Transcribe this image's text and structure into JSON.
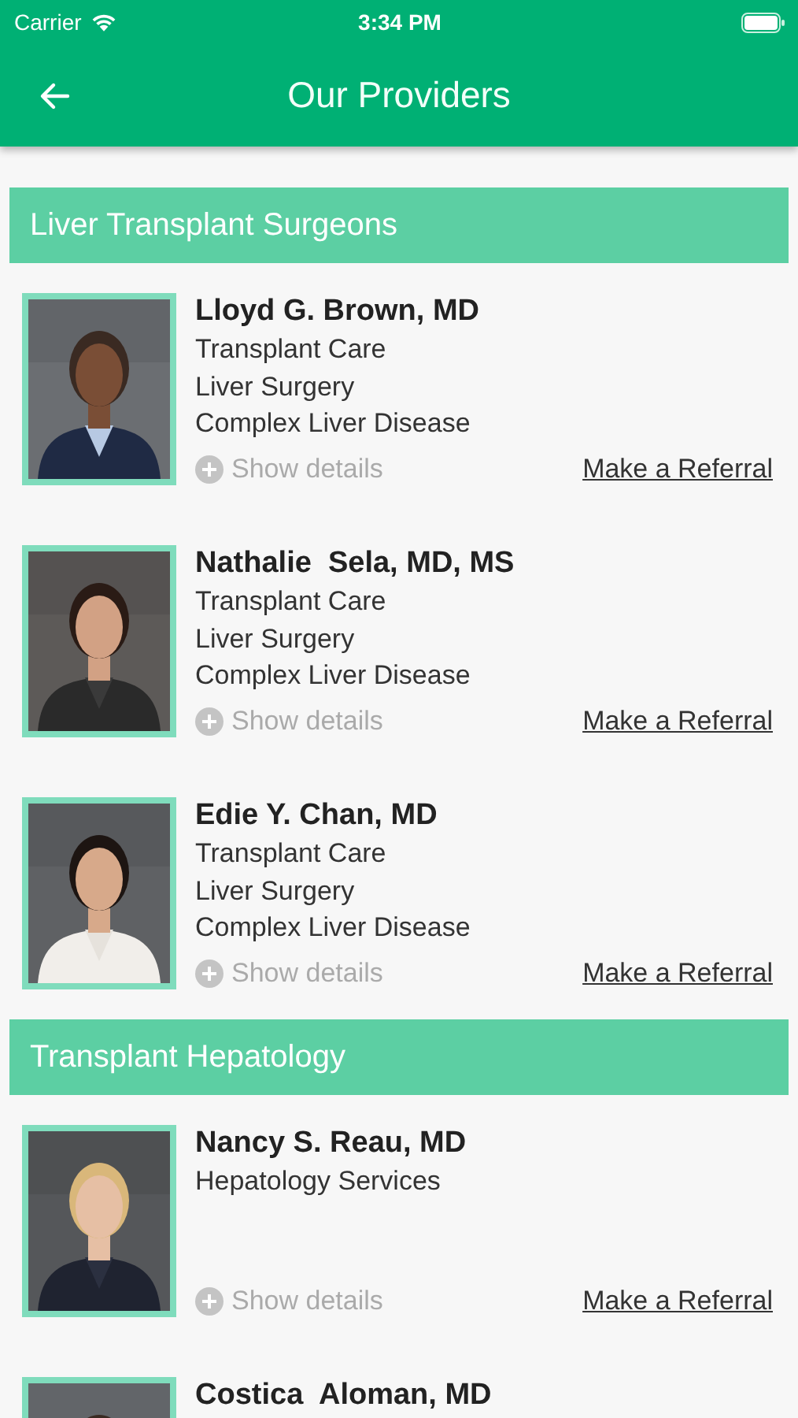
{
  "status_bar": {
    "carrier": "Carrier",
    "time": "3:34 PM"
  },
  "header": {
    "title": "Our Providers"
  },
  "sections": [
    {
      "title": "Liver Transplant Surgeons",
      "providers": [
        {
          "name": "Lloyd G. Brown, MD",
          "specialties": [
            "Transplant Care",
            "Liver Surgery",
            "Complex Liver Disease"
          ],
          "details_label": "Show details",
          "referral_label": "Make a Referral",
          "photo": {
            "kind": "picture"
          }
        },
        {
          "name": "Nathalie  Sela, MD, MS",
          "specialties": [
            "Transplant Care",
            "Liver Surgery",
            "Complex Liver Disease"
          ],
          "details_label": "Show details",
          "referral_label": "Make a Referral",
          "photo": {
            "kind": "picture"
          }
        },
        {
          "name": "Edie Y. Chan, MD",
          "specialties": [
            "Transplant Care",
            "Liver Surgery",
            "Complex Liver Disease"
          ],
          "details_label": "Show details",
          "referral_label": "Make a Referral",
          "photo": {
            "kind": "picture"
          }
        }
      ]
    },
    {
      "title": "Transplant Hepatology",
      "providers": [
        {
          "name": "Nancy S. Reau, MD",
          "specialties": [
            "Hepatology Services"
          ],
          "details_label": "Show details",
          "referral_label": "Make a Referral",
          "photo": {
            "kind": "picture"
          }
        },
        {
          "name": "Costica  Aloman, MD",
          "photo": {
            "kind": "picture"
          }
        }
      ]
    }
  ]
}
